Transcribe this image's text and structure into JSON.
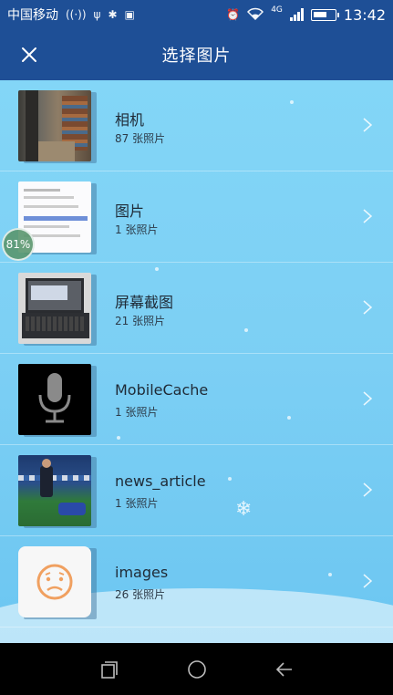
{
  "status_bar": {
    "carrier": "中国移动",
    "time": "13:42",
    "network": "4G"
  },
  "header": {
    "title": "选择图片"
  },
  "albums": [
    {
      "name": "相机",
      "count": "87 张照片"
    },
    {
      "name": "图片",
      "count": "1 张照片"
    },
    {
      "name": "屏幕截图",
      "count": "21 张照片"
    },
    {
      "name": "MobileCache",
      "count": "1 张照片"
    },
    {
      "name": "news_article",
      "count": "1 张照片"
    },
    {
      "name": "images",
      "count": "26 张照片"
    }
  ],
  "floating_badge": {
    "text": "81%"
  },
  "colors": {
    "header_bg": "#1e4f96",
    "list_bg": "#7ccff4",
    "nav_bg": "#000000"
  }
}
